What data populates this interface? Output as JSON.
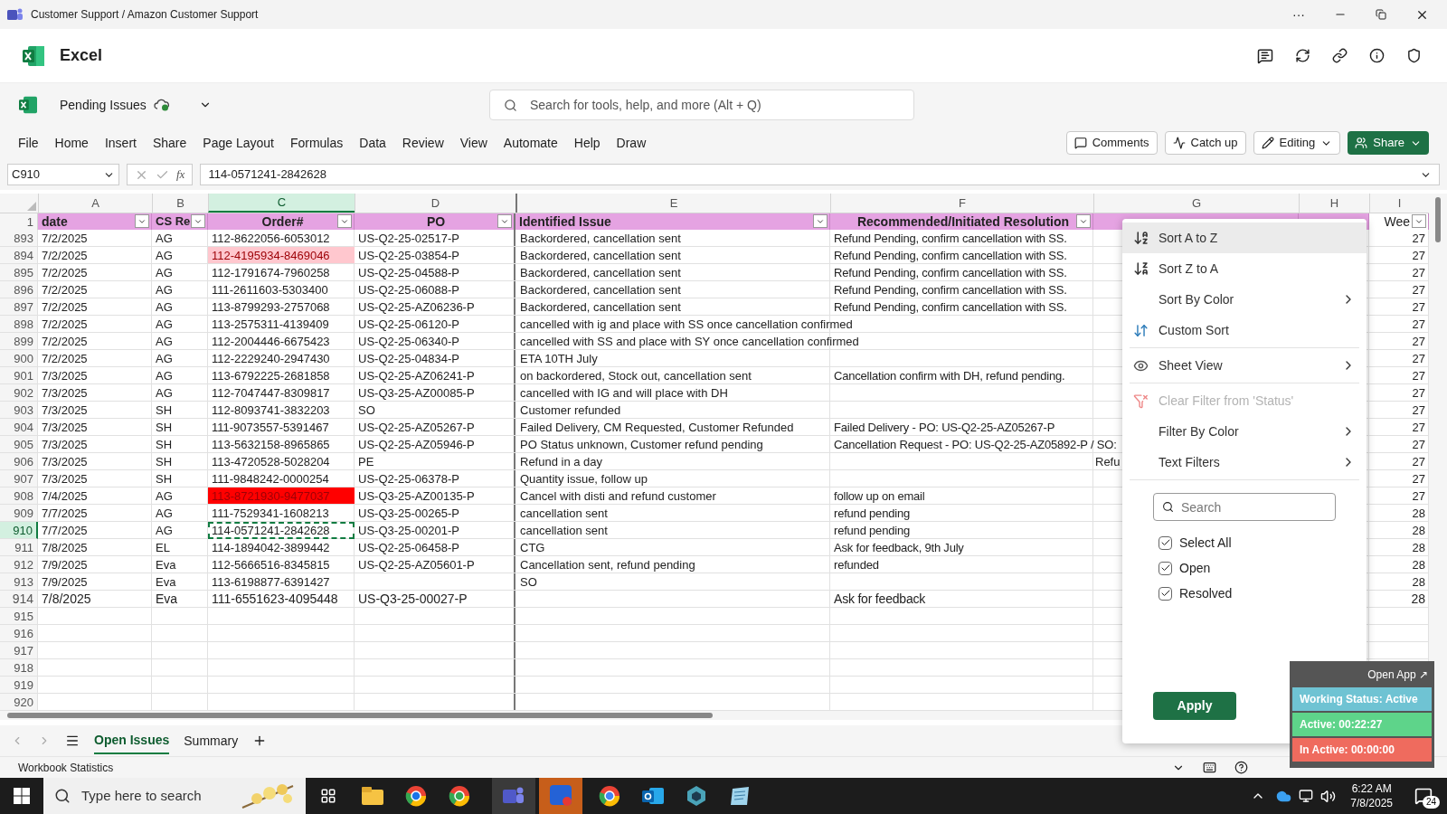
{
  "window": {
    "title": "Customer Support / Amazon Customer Support",
    "more": "···"
  },
  "app": {
    "name": "Excel"
  },
  "file": {
    "name": "Pending Issues"
  },
  "search": {
    "placeholder": "Search for tools, help, and more (Alt + Q)"
  },
  "ribbon_tabs": [
    "File",
    "Home",
    "Insert",
    "Share",
    "Page Layout",
    "Formulas",
    "Data",
    "Review",
    "View",
    "Automate",
    "Help",
    "Draw"
  ],
  "ribbon_buttons": [
    {
      "label": "Comments",
      "kind": "comments"
    },
    {
      "label": "Catch up",
      "kind": "catchup"
    },
    {
      "label": "Editing",
      "kind": "editing"
    },
    {
      "label": "Share",
      "kind": "share"
    }
  ],
  "formula_bar": {
    "name_box": "C910",
    "fx": "fx",
    "value": "114-0571241-2842628"
  },
  "columns": [
    {
      "letter": "A",
      "selected": false
    },
    {
      "letter": "B",
      "selected": false
    },
    {
      "letter": "C",
      "selected": true
    },
    {
      "letter": "D",
      "selected": false
    },
    {
      "letter": "E",
      "selected": false
    },
    {
      "letter": "F",
      "selected": false
    },
    {
      "letter": "G",
      "selected": false
    },
    {
      "letter": "H",
      "selected": false
    },
    {
      "letter": "I",
      "selected": false
    }
  ],
  "header_row": {
    "num": "1",
    "cells": [
      "date",
      "CS Re",
      "Order#",
      "PO",
      "Identified Issue",
      "Recommended/Initiated Resolution",
      "",
      "",
      "Wee"
    ]
  },
  "rows": [
    {
      "num": "893",
      "date": "7/2/2025",
      "rep": "AG",
      "order": "112-8622056-6053012",
      "po": "US-Q2-25-02517-P",
      "issue": "Backordered, cancellation sent",
      "resolution": "Refund Pending, confirm cancellation with SS.",
      "week": "27",
      "selected": false
    },
    {
      "num": "894",
      "date": "7/2/2025",
      "rep": "AG",
      "order": "112-4195934-8469046",
      "highlight": {
        "color": "#ffc7ce"
      },
      "po": "US-Q2-25-03854-P",
      "issue": "Backordered, cancellation sent",
      "resolution": "Refund Pending, confirm cancellation with SS.",
      "week": "27",
      "selected": false
    },
    {
      "num": "895",
      "date": "7/2/2025",
      "rep": "AG",
      "order": "112-1791674-7960258",
      "po": "US-Q2-25-04588-P",
      "issue": "Backordered, cancellation sent",
      "resolution": "Refund Pending, confirm cancellation with SS.",
      "week": "27",
      "selected": false
    },
    {
      "num": "896",
      "date": "7/2/2025",
      "rep": "AG",
      "order": "111-2611603-5303400",
      "po": "US-Q2-25-06088-P",
      "issue": "Backordered, cancellation sent",
      "resolution": "Refund Pending, confirm cancellation with SS.",
      "week": "27",
      "selected": false
    },
    {
      "num": "897",
      "date": "7/2/2025",
      "rep": "AG",
      "order": "113-8799293-2757068",
      "po": "US-Q2-25-AZ06236-P",
      "issue": "Backordered, cancellation sent",
      "resolution": "Refund Pending, confirm cancellation with SS.",
      "week": "27",
      "selected": false
    },
    {
      "num": "898",
      "date": "7/2/2025",
      "rep": "AG",
      "order": "113-2575311-4139409",
      "po": "US-Q2-25-06120-P",
      "issue": "cancelled with ig and place with SS once cancellation confirmed",
      "week": "27",
      "selected": false
    },
    {
      "num": "899",
      "date": "7/2/2025",
      "rep": "AG",
      "order": "112-2004446-6675423",
      "po": "US-Q2-25-06340-P",
      "issue": "cancelled with SS and place with SY once cancellation confirmed",
      "week": "27",
      "selected": false
    },
    {
      "num": "900",
      "date": "7/2/2025",
      "rep": "AG",
      "order": "112-2229240-2947430",
      "po": "US-Q2-25-04834-P",
      "issue": "ETA 10TH July",
      "week": "27",
      "selected": false
    },
    {
      "num": "901",
      "date": "7/3/2025",
      "rep": "AG",
      "order": "113-6792225-2681858",
      "po": "US-Q2-25-AZ06241-P",
      "issue": "on backordered, Stock out, cancellation sent",
      "resolution": "Cancellation confirm with DH, refund pending.",
      "week": "27",
      "selected": false
    },
    {
      "num": "902",
      "date": "7/3/2025",
      "rep": "AG",
      "order": "112-7047447-8309817",
      "po": "US-Q3-25-AZ00085-P",
      "issue": "cancelled with IG and will place with DH",
      "week": "27",
      "selected": false
    },
    {
      "num": "903",
      "date": "7/3/2025",
      "rep": "SH",
      "order": "112-8093741-3832203",
      "po": "SO",
      "issue": "Customer refunded",
      "week": "27",
      "selected": false
    },
    {
      "num": "904",
      "date": "7/3/2025",
      "rep": "SH",
      "order": "111-9073557-5391467",
      "po": "US-Q2-25-AZ05267-P",
      "issue": "Failed Delivery, CM Requested, Customer Refunded",
      "resolution": "Failed Delivery - PO: US-Q2-25-AZ05267-P",
      "week": "27",
      "selected": false
    },
    {
      "num": "905",
      "date": "7/3/2025",
      "rep": "SH",
      "order": "113-5632158-8965865",
      "po": "US-Q2-25-AZ05946-P",
      "issue": "PO Status unknown, Customer refund pending",
      "resolution": "Cancellation Request - PO: US-Q2-25-AZ05892-P / SO:",
      "week": "27",
      "selected": false
    },
    {
      "num": "906",
      "date": "7/3/2025",
      "rep": "SH",
      "order": "113-4720528-5028204",
      "po": "PE",
      "issue": "Refund in a day",
      "column_g": "Refu",
      "week": "27",
      "selected": false
    },
    {
      "num": "907",
      "date": "7/3/2025",
      "rep": "SH",
      "order": "111-9848242-0000254",
      "po": "US-Q2-25-06378-P",
      "issue": "Quantity issue, follow up",
      "week": "27",
      "selected": false
    },
    {
      "num": "908",
      "date": "7/4/2025",
      "rep": "AG",
      "order": "113-8721930-9477037",
      "highlight": {
        "color": "#ff0000"
      },
      "po": "US-Q3-25-AZ00135-P",
      "issue": "Cancel with disti and refund customer",
      "resolution": "follow up on email",
      "week": "27",
      "selected": false
    },
    {
      "num": "909",
      "date": "7/7/2025",
      "rep": "AG",
      "order": "111-7529341-1608213",
      "po": "US-Q3-25-00265-P",
      "issue": "cancellation sent",
      "resolution": "refund pending",
      "week": "28",
      "selected": false
    },
    {
      "num": "910",
      "date": "7/7/2025",
      "rep": "AG",
      "order": "114-0571241-2842628",
      "po": "US-Q3-25-00201-P",
      "issue": "cancellation sent",
      "resolution": "refund pending",
      "week": "28",
      "selected": true
    },
    {
      "num": "911",
      "date": "7/8/2025",
      "rep": "EL",
      "order": "114-1894042-3899442",
      "po": "US-Q2-25-06458-P",
      "issue": "CTG",
      "resolution": "Ask for feedback, 9th July",
      "week": "28",
      "selected": false
    },
    {
      "num": "912",
      "date": "7/9/2025",
      "rep": "Eva",
      "order": "112-5666516-8345815",
      "po": "US-Q2-25-AZ05601-P",
      "issue": "Cancellation sent, refund pending",
      "resolution": "refunded",
      "week": "28",
      "selected": false
    },
    {
      "num": "913",
      "date": "7/9/2025",
      "rep": "Eva",
      "order": "113-6198877-6391427",
      "issue": "SO",
      "week": "28",
      "selected": false
    },
    {
      "num": "914",
      "date": "7/8/2025",
      "rep": "Eva",
      "order": "111-6551623-4095448",
      "po": "US-Q3-25-00027-P",
      "resolution": "Ask for feedback",
      "week": "28",
      "selected": false
    }
  ],
  "empty_rows": [
    "915",
    "916",
    "917",
    "918",
    "919",
    "920"
  ],
  "filter_menu": {
    "items": [
      {
        "label": "Sort A to Z",
        "submenu": false,
        "disabled": false,
        "highlighted": true,
        "separator_after": false
      },
      {
        "label": "Sort Z to A",
        "submenu": false,
        "disabled": false,
        "highlighted": false,
        "separator_after": false
      },
      {
        "label": "Sort By Color",
        "submenu": true,
        "disabled": false,
        "highlighted": false,
        "separator_after": false
      },
      {
        "label": "Custom Sort",
        "submenu": false,
        "disabled": false,
        "highlighted": false,
        "separator_after": true
      },
      {
        "label": "Sheet View",
        "submenu": true,
        "disabled": false,
        "highlighted": false,
        "separator_after": true
      },
      {
        "label": "Clear Filter from 'Status'",
        "submenu": false,
        "disabled": true,
        "highlighted": false,
        "separator_after": false
      },
      {
        "label": "Filter By Color",
        "submenu": true,
        "disabled": false,
        "highlighted": false,
        "separator_after": false
      },
      {
        "label": "Text Filters",
        "submenu": true,
        "disabled": false,
        "highlighted": false,
        "separator_after": true
      }
    ],
    "search_placeholder": "Search",
    "values": [
      {
        "label": "Select All",
        "checked": true
      },
      {
        "label": "Open",
        "checked": true
      },
      {
        "label": "Resolved",
        "checked": true
      }
    ],
    "apply": "Apply"
  },
  "status_widget": {
    "open_app": "Open App ↗",
    "lines": [
      {
        "text": "Working Status: Active",
        "color": "#6fc3d3"
      },
      {
        "text": "Active: 00:22:27",
        "color": "#5ed48a"
      },
      {
        "text": "In Active: 00:00:00",
        "color": "#ef6b5e"
      }
    ]
  },
  "sheet_tabs": [
    {
      "label": "Open Issues",
      "selected": true
    },
    {
      "label": "Summary",
      "selected": false
    }
  ],
  "status_bar": {
    "text": "Workbook Statistics"
  },
  "taskbar": {
    "search_placeholder": "Type here to search",
    "time": "6:22 AM",
    "date": "7/8/2025",
    "notifications": "24"
  }
}
